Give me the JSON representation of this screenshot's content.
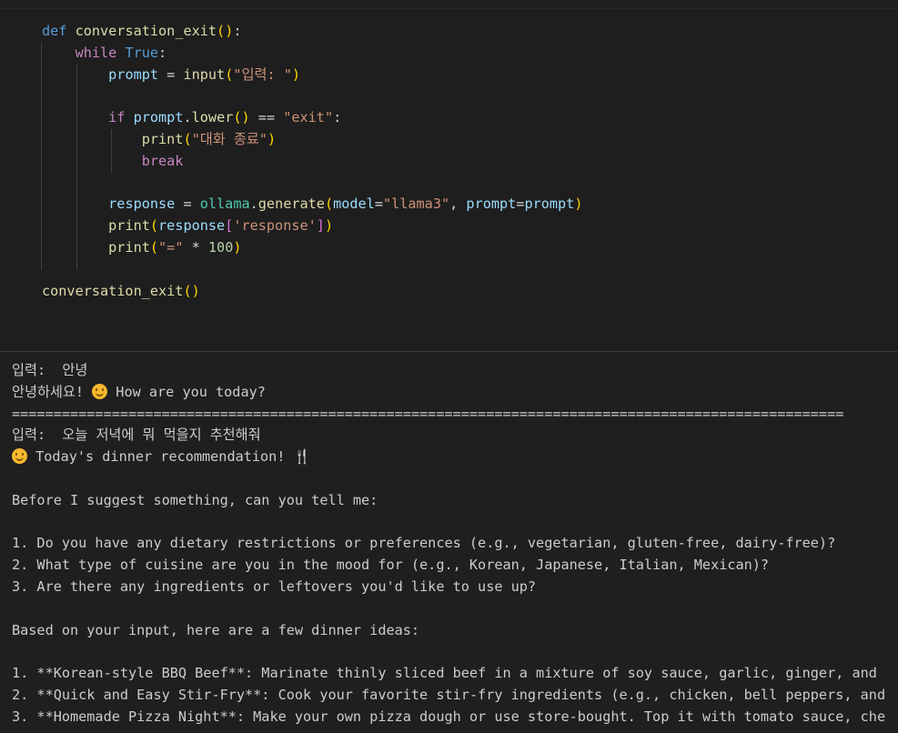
{
  "code_lines": [
    "def conversation_exit():",
    "    while True:",
    "        prompt = input(\"입력: \")",
    "",
    "        if prompt.lower() == \"exit\":",
    "            print(\"대화 종료\")",
    "            break",
    "",
    "        response = ollama.generate(model=\"llama3\", prompt=prompt)",
    "        print(response['response'])",
    "        print(\"=\" * 100)",
    "",
    "conversation_exit()"
  ],
  "output": {
    "input1": "입력:  안녕",
    "reply1_pre": "안녕하세요! ",
    "reply1_emoji": "smiling-face-emoji",
    "reply1_post": " How are you today?",
    "separator": "====================================================================================================",
    "input2": "입력:  오늘 저녁에 뭐 먹을지 추천해줘",
    "reply2_emoji": "smiling-face-emoji",
    "reply2_title": " Today's dinner recommendation! ",
    "reply2_icon": "🍴",
    "question_intro": "Before I suggest something, can you tell me:",
    "questions": [
      "1. Do you have any dietary restrictions or preferences (e.g., vegetarian, gluten-free, dairy-free)?",
      "2. What type of cuisine are you in the mood for (e.g., Korean, Japanese, Italian, Mexican)?",
      "3. Are there any ingredients or leftovers you'd like to use up?"
    ],
    "ideas_intro": "Based on your input, here are a few dinner ideas:",
    "ideas": [
      "1. **Korean-style BBQ Beef**: Marinate thinly sliced beef in a mixture of soy sauce, garlic, ginger, and",
      "2. **Quick and Easy Stir-Fry**: Cook your favorite stir-fry ingredients (e.g., chicken, bell peppers, and",
      "3. **Homemade Pizza Night**: Make your own pizza dough or use store-bought. Top it with tomato sauce, che"
    ]
  },
  "colors": {
    "keyword": "#569cd6",
    "control": "#c586c0",
    "function": "#dcdcaa",
    "variable": "#9cdcfe",
    "string": "#ce9178",
    "number": "#b5cea8",
    "background": "#1e1e1e"
  }
}
